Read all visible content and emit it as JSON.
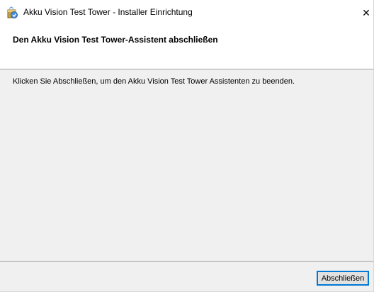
{
  "window": {
    "title": "Akku Vision Test Tower - Installer Einrichtung",
    "icon": "installer-icon",
    "close_glyph": "✕"
  },
  "header": {
    "title": "Den Akku Vision Test Tower-Assistent abschließen"
  },
  "content": {
    "message": "Klicken Sie Abschließen, um den Akku Vision Test Tower Assistenten zu beenden."
  },
  "footer": {
    "finish_label": "Abschließen"
  },
  "colors": {
    "accent": "#0078d7",
    "panel": "#f0f0f0",
    "white": "#ffffff"
  }
}
